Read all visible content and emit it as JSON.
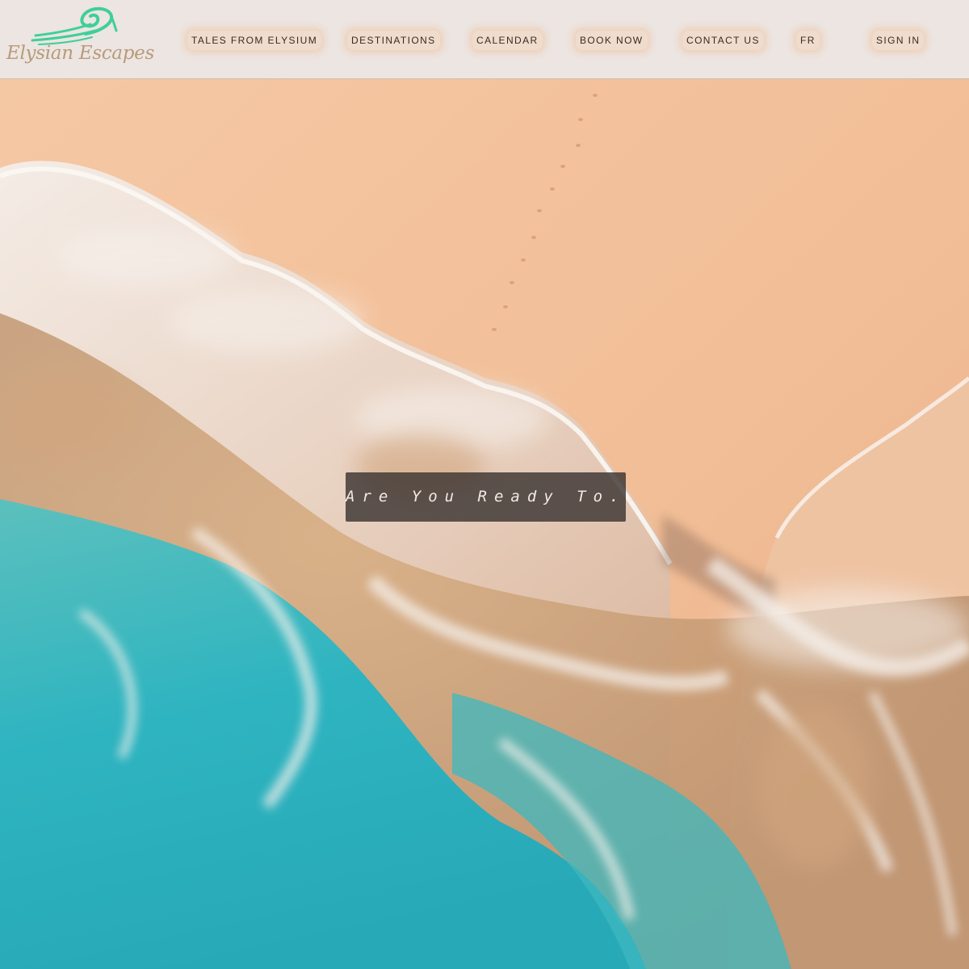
{
  "brand": {
    "name": "Elysian Escapes",
    "logo_icon": "wave-swirl-icon",
    "logo_color": "#3fcf9a",
    "text_color": "#b89a7b"
  },
  "nav": {
    "items": [
      {
        "id": "tales",
        "label": "TALES FROM ELYSIUM"
      },
      {
        "id": "destinations",
        "label": "DESTINATIONS"
      },
      {
        "id": "calendar",
        "label": "CALENDAR"
      },
      {
        "id": "book",
        "label": "BOOK NOW"
      },
      {
        "id": "contact",
        "label": "CONTACT US"
      },
      {
        "id": "lang",
        "label": "FR"
      },
      {
        "id": "signin",
        "label": "SIGN IN"
      }
    ]
  },
  "hero": {
    "tagline": "Are You Ready To..",
    "colors": {
      "sand": "#f2bf98",
      "foam": "#f3ede8",
      "ocean": "#2fb7c2",
      "shallow": "#c9a078"
    }
  }
}
